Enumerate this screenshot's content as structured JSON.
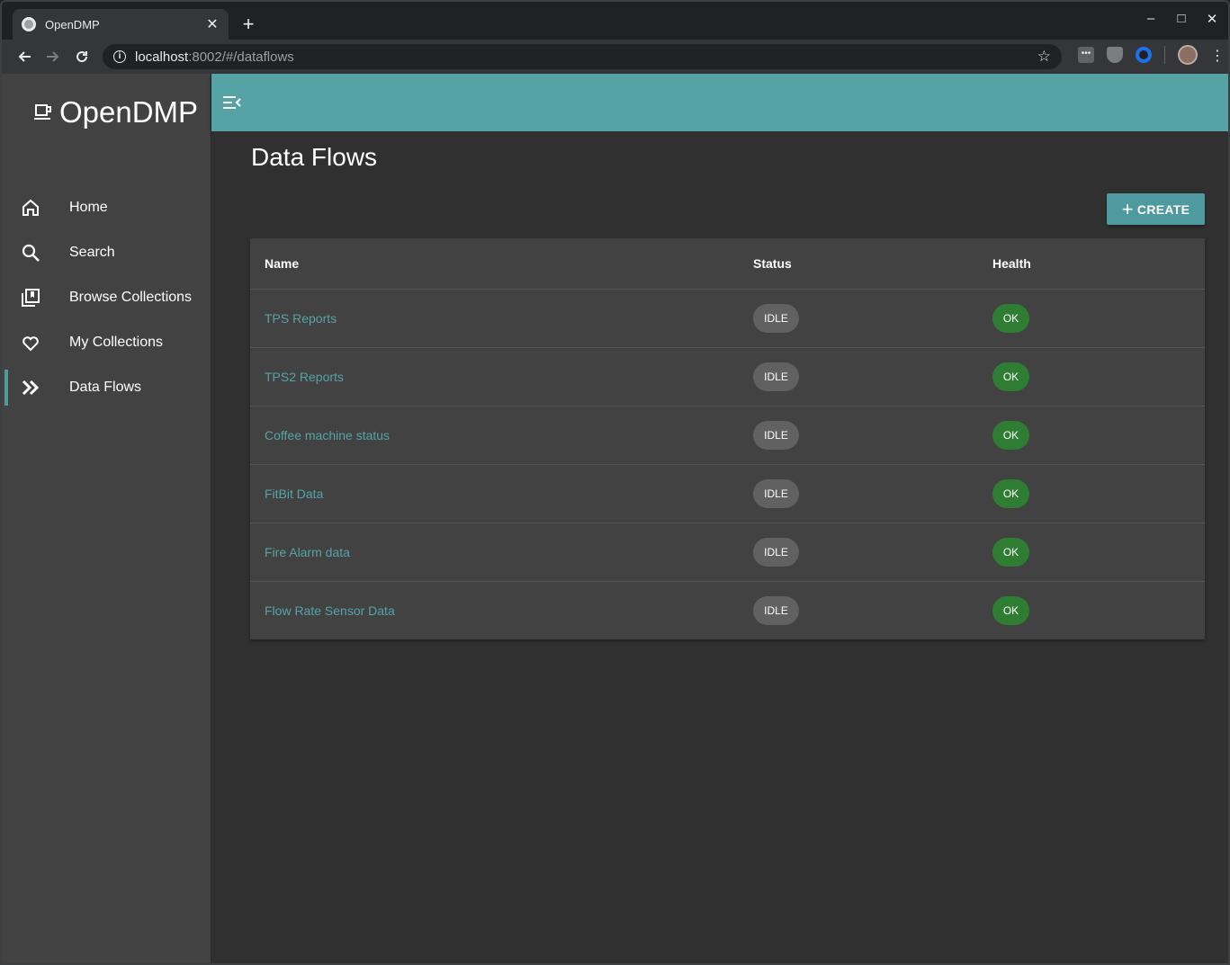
{
  "browser": {
    "tab_title": "OpenDMP",
    "tab_close": "✕",
    "new_tab": "+",
    "url_host": "localhost",
    "url_rest": ":8002/#/dataflows",
    "window_controls": {
      "minimize": "–",
      "maximize": "□",
      "close": "✕"
    }
  },
  "sidebar": {
    "brand": "OpenDMP",
    "items": [
      {
        "label": "Home",
        "icon": "home-icon",
        "active": false
      },
      {
        "label": "Search",
        "icon": "search-icon",
        "active": false
      },
      {
        "label": "Browse Collections",
        "icon": "library-icon",
        "active": false
      },
      {
        "label": "My Collections",
        "icon": "heart-icon",
        "active": false
      },
      {
        "label": "Data Flows",
        "icon": "double-chevron-icon",
        "active": true
      }
    ]
  },
  "main": {
    "title": "Data Flows",
    "create_label": "CREATE",
    "table": {
      "headers": [
        "Name",
        "Status",
        "Health"
      ],
      "rows": [
        {
          "name": "TPS Reports",
          "status": "IDLE",
          "health": "OK"
        },
        {
          "name": "TPS2 Reports",
          "status": "IDLE",
          "health": "OK"
        },
        {
          "name": "Coffee machine status",
          "status": "IDLE",
          "health": "OK"
        },
        {
          "name": "FitBit Data",
          "status": "IDLE",
          "health": "OK"
        },
        {
          "name": "Fire Alarm data",
          "status": "IDLE",
          "health": "OK"
        },
        {
          "name": "Flow Rate Sensor Data",
          "status": "IDLE",
          "health": "OK"
        }
      ]
    }
  },
  "colors": {
    "accent": "#56a3a6",
    "sidebar_bg": "#424242",
    "content_bg": "#303030",
    "ok_chip": "#2e7d32",
    "idle_chip": "#616161"
  }
}
